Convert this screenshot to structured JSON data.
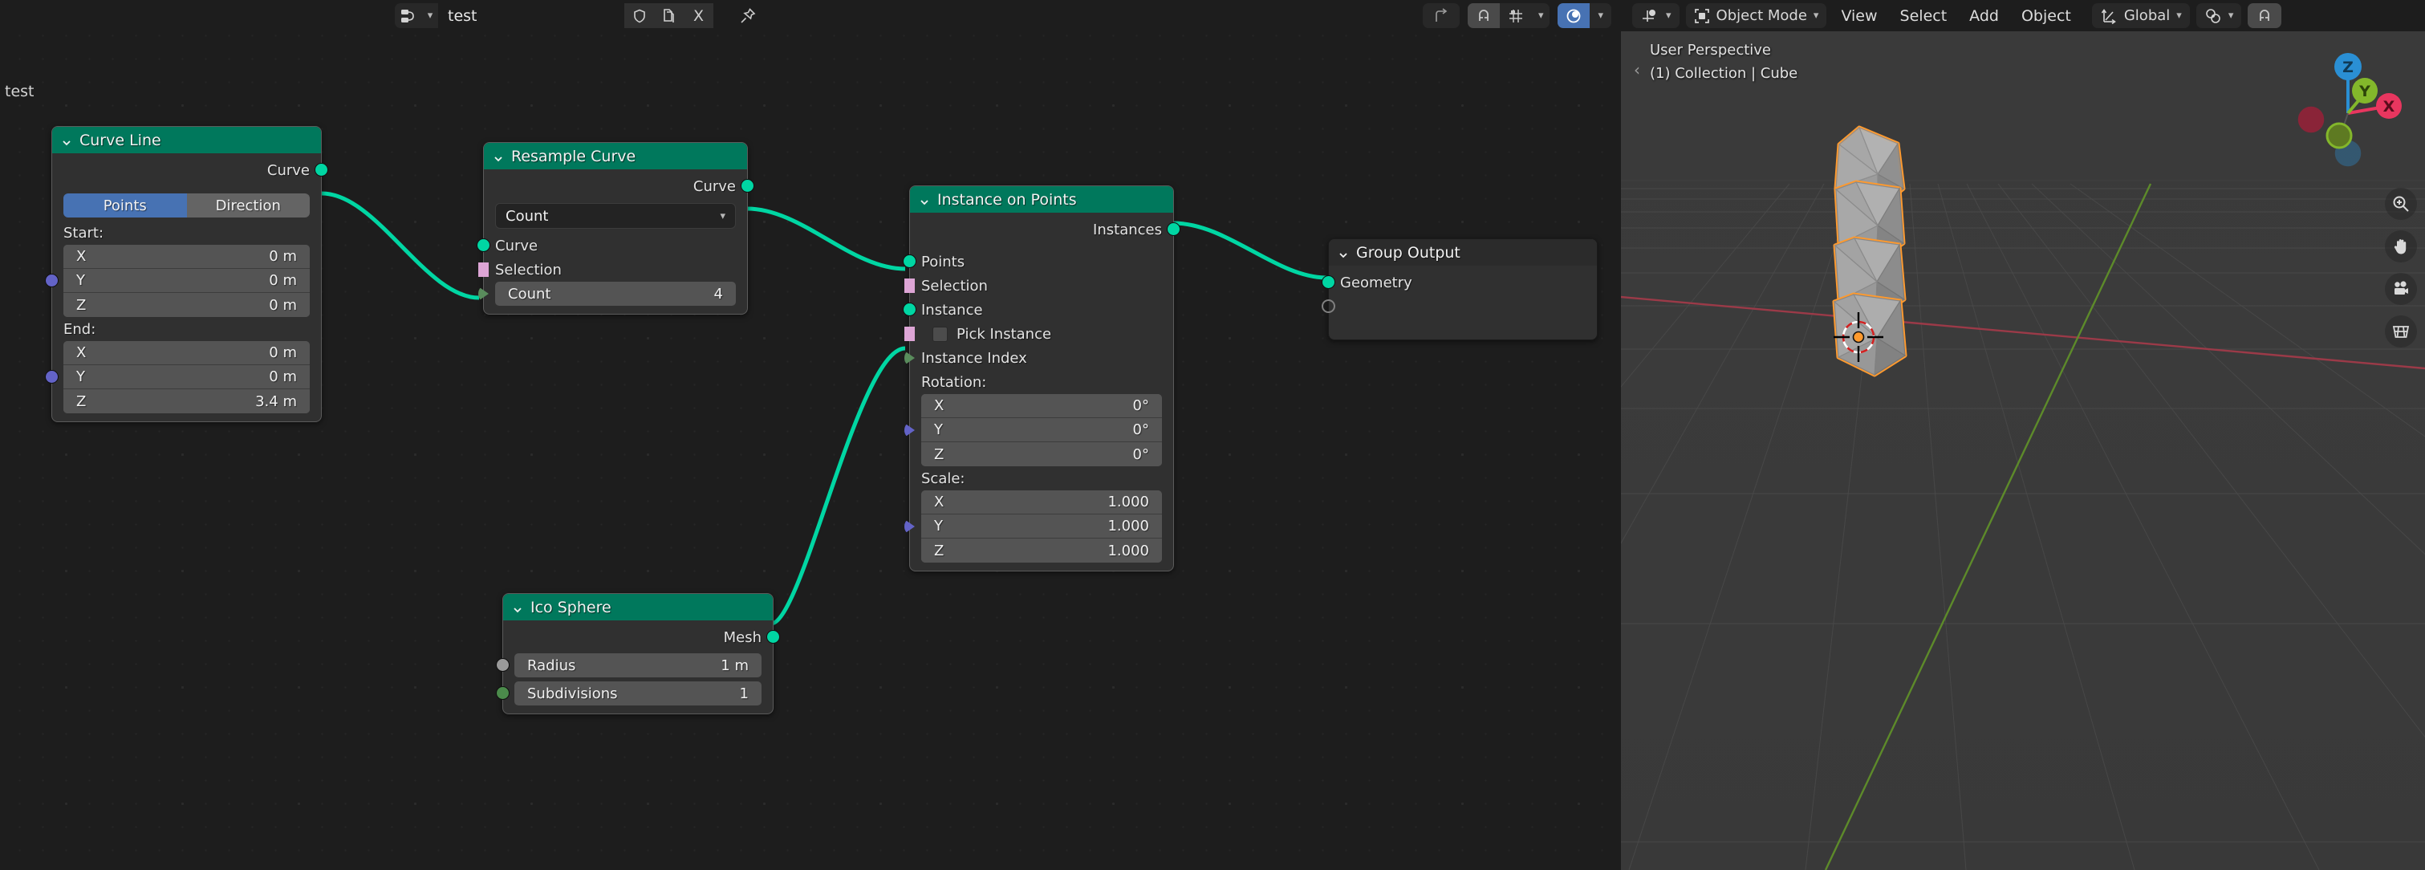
{
  "node_editor": {
    "header": {
      "browse_icon": "node-tree-browse-icon",
      "tree_name": "test",
      "shield_icon": "fake-user-icon",
      "copy_icon": "new-datablock-icon",
      "unlink_label": "X",
      "pin_icon": "pin-icon",
      "snap_icon": "snap-magnet-icon",
      "snap_to_icon": "snap-increment-icon",
      "proportional_icon": "proportional-editing-icon",
      "parent_icon": "go-to-parent-icon"
    },
    "canvas_label": "test",
    "nodes": [
      {
        "id": "curve-line",
        "title": "Curve Line",
        "outputs": [
          {
            "name": "Curve",
            "type": "geometry"
          }
        ],
        "mode_toggle": {
          "on": "Points",
          "off": "Direction"
        },
        "sections": [
          {
            "label": "Start:",
            "fields": [
              {
                "label": "X",
                "value": "0 m"
              },
              {
                "label": "Y",
                "value": "0 m"
              },
              {
                "label": "Z",
                "value": "0 m"
              }
            ]
          },
          {
            "label": "End:",
            "fields": [
              {
                "label": "X",
                "value": "0 m"
              },
              {
                "label": "Y",
                "value": "0 m"
              },
              {
                "label": "Z",
                "value": "3.4 m"
              }
            ]
          }
        ]
      },
      {
        "id": "resample-curve",
        "title": "Resample Curve",
        "outputs": [
          {
            "name": "Curve",
            "type": "geometry"
          }
        ],
        "dropdown_value": "Count",
        "inputs": [
          {
            "name": "Curve",
            "type": "geometry"
          },
          {
            "name": "Selection",
            "type": "boolean"
          }
        ],
        "widgets": [
          {
            "label": "Count",
            "value": "4"
          }
        ]
      },
      {
        "id": "instance-on-points",
        "title": "Instance on Points",
        "outputs": [
          {
            "name": "Instances",
            "type": "geometry"
          }
        ],
        "inputs": [
          {
            "name": "Points",
            "type": "geometry"
          },
          {
            "name": "Selection",
            "type": "boolean"
          },
          {
            "name": "Instance",
            "type": "geometry"
          },
          {
            "name": "Pick Instance",
            "type": "boolean",
            "checked": false
          },
          {
            "name": "Instance Index",
            "type": "integer"
          }
        ],
        "sections": [
          {
            "label": "Rotation:",
            "fields": [
              {
                "label": "X",
                "value": "0°"
              },
              {
                "label": "Y",
                "value": "0°"
              },
              {
                "label": "Z",
                "value": "0°"
              }
            ]
          },
          {
            "label": "Scale:",
            "fields": [
              {
                "label": "X",
                "value": "1.000"
              },
              {
                "label": "Y",
                "value": "1.000"
              },
              {
                "label": "Z",
                "value": "1.000"
              }
            ]
          }
        ]
      },
      {
        "id": "ico-sphere",
        "title": "Ico Sphere",
        "outputs": [
          {
            "name": "Mesh",
            "type": "geometry"
          }
        ],
        "widgets": [
          {
            "label": "Radius",
            "value": "1 m"
          },
          {
            "label": "Subdivisions",
            "value": "1"
          }
        ]
      },
      {
        "id": "group-output",
        "title": "Group Output",
        "inputs": [
          {
            "name": "Geometry",
            "type": "geometry"
          }
        ]
      }
    ]
  },
  "viewport": {
    "header": {
      "editor_type_icon": "geometry-nodes-editor-icon",
      "mode_icon": "object-mode-icon",
      "mode": "Object Mode",
      "menus": [
        "View",
        "Select",
        "Add",
        "Object"
      ],
      "orientation_icon": "transform-orientation-icon",
      "orientation": "Global",
      "pivot_icon": "pivot-point-icon",
      "snap_icon": "snap-magnet-icon"
    },
    "overlay": {
      "perspective": "User Perspective",
      "scene_info": "(1) Collection | Cube",
      "collapse_icon": "sidebar-collapse-icon"
    },
    "tools": [
      {
        "icon": "zoom-icon"
      },
      {
        "icon": "pan-hand-icon"
      },
      {
        "icon": "camera-icon"
      },
      {
        "icon": "ortho-grid-icon"
      }
    ],
    "gizmo": {
      "axes": [
        "X",
        "Y",
        "Z"
      ],
      "colors": {
        "x": "#e8365f",
        "y": "#83b72b",
        "z": "#2a8fd4"
      }
    }
  },
  "colors": {
    "geometry_socket": "#00d6a3",
    "boolean_socket": "#dda5d5",
    "integer_socket": "#598c5c",
    "vector_socket": "#6363c7",
    "node_header_geo": "#00785c",
    "accent_blue": "#4772b3",
    "selection_orange": "#ff9a2e",
    "noodle": "#00d6a3"
  }
}
